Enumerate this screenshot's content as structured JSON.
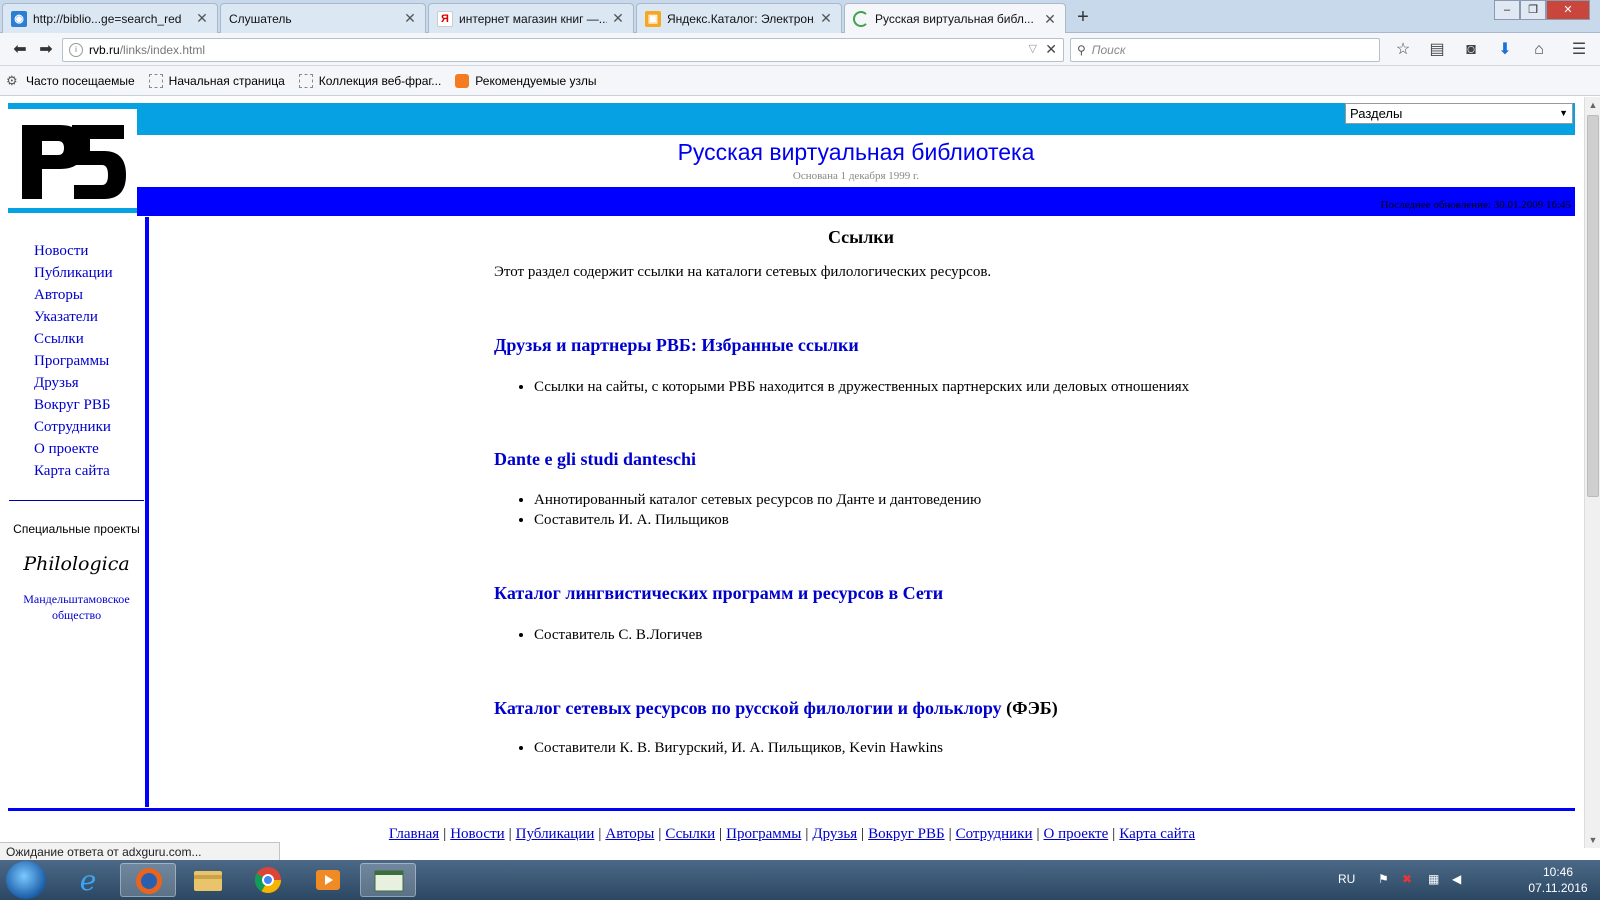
{
  "browser": {
    "tabs": [
      {
        "title": "http://biblio...ge=search_red",
        "icon_color": "#2a7fd3",
        "icon": "globe-icon"
      },
      {
        "title": "Слушатель",
        "icon_color": "#ffffff",
        "icon": "blank-page-icon"
      },
      {
        "title": "интернет магазин книг —...",
        "icon_color": "#ffffff",
        "icon": "yandex-icon",
        "icon_glyph": "Я"
      },
      {
        "title": "Яндекс.Каталог: Электрон...",
        "icon_color": "#f5a623",
        "icon": "yandex-catalog-icon"
      },
      {
        "title": "Русская виртуальная библ...",
        "icon_color": "#3fa34d",
        "icon": "loading-icon"
      }
    ],
    "url_host": "rvb.ru",
    "url_path": "/links/index.html",
    "search_placeholder": "Поиск",
    "bookmarks": [
      "Часто посещаемые",
      "Начальная страница",
      "Коллекция веб-фраг...",
      "Рекомендуемые узлы"
    ],
    "status_text": "Ожидание ответа от adxguru.com..."
  },
  "site": {
    "sections_select": "Разделы",
    "title": "Русская виртуальная библиотека",
    "subtitle": "Основана 1 декабря 1999 г.",
    "last_update": "Последнее обновление: 30.01.2009 16:45",
    "logo_text": "РБ"
  },
  "sidebar": {
    "items": [
      "Новости",
      "Публикации",
      "Авторы",
      "Указатели",
      "Ссылки",
      "Программы",
      "Друзья",
      "Вокруг РВБ",
      "Сотрудники",
      "О проекте",
      "Карта сайта"
    ],
    "special_title": "Специальные проекты",
    "philologica": "Philologica",
    "mandelstam": "Мандельштамовское общество"
  },
  "content": {
    "heading": "Ссылки",
    "intro": "Этот раздел содержит ссылки на каталоги сетевых филологических ресурсов.",
    "sections": [
      {
        "title": "Друзья и партнеры РВБ: Избранные ссылки",
        "suffix": "",
        "items": [
          "Ссылки на сайты, с которыми РВБ находится в дружественных партнерских или деловых отношениях"
        ]
      },
      {
        "title": "Dante e gli studi danteschi",
        "suffix": "",
        "items": [
          "Аннотированный каталог сетевых ресурсов по Данте и дантоведению",
          "Составитель И. А. Пильщиков"
        ]
      },
      {
        "title": "Каталог лингвистических программ и ресурсов в Сети",
        "suffix": "",
        "items": [
          "Составитель С. В.Логичев"
        ]
      },
      {
        "title": "Каталог сетевых ресурсов по русской филологии и фольклору",
        "suffix": " (ФЭБ)",
        "items": [
          "Составители К. В. Вигурский, И. А. Пильщиков, Kevin Hawkins"
        ]
      }
    ]
  },
  "footer": {
    "links": [
      "Главная",
      "Новости",
      "Публикации",
      "Авторы",
      "Ссылки",
      "Программы",
      "Друзья",
      "Вокруг РВБ",
      "Сотрудники",
      "О проекте",
      "Карта сайта"
    ]
  },
  "taskbar": {
    "lang": "RU",
    "time": "10:46",
    "date": "07.11.2016"
  },
  "colors": {
    "accent_light": "#06a1e3",
    "accent_dark": "#0000ff",
    "link": "#0000cc"
  }
}
